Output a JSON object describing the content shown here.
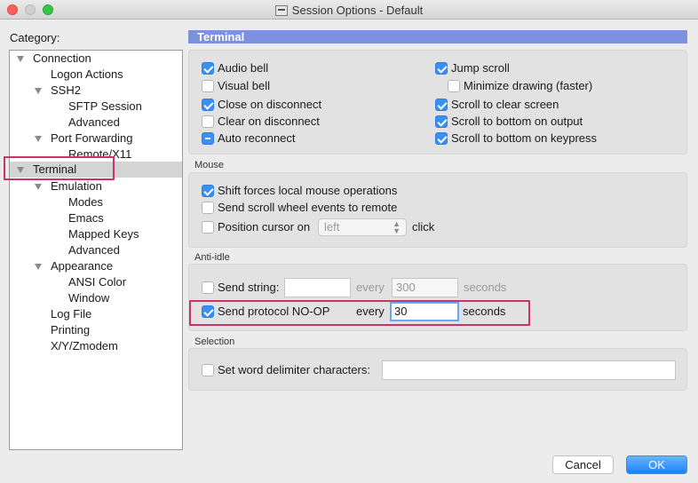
{
  "window": {
    "title": "Session Options - Default"
  },
  "category_label": "Category:",
  "tree": {
    "connection": "Connection",
    "logon_actions": "Logon Actions",
    "ssh2": "SSH2",
    "sftp_session": "SFTP Session",
    "advanced_ssh": "Advanced",
    "port_forwarding": "Port Forwarding",
    "remote_x11": "Remote/X11",
    "terminal": "Terminal",
    "emulation": "Emulation",
    "modes": "Modes",
    "emacs": "Emacs",
    "mapped_keys": "Mapped Keys",
    "advanced_emul": "Advanced",
    "appearance": "Appearance",
    "ansi_color": "ANSI Color",
    "window": "Window",
    "log_file": "Log File",
    "printing": "Printing",
    "xyzmodem": "X/Y/Zmodem"
  },
  "section_title": "Terminal",
  "terminal_options": {
    "audio_bell": {
      "label": "Audio bell",
      "checked": true
    },
    "visual_bell": {
      "label": "Visual bell",
      "checked": false
    },
    "close_on_disconnect": {
      "label": "Close on disconnect",
      "checked": true
    },
    "clear_on_disconnect": {
      "label": "Clear on disconnect",
      "checked": false
    },
    "auto_reconnect": {
      "label": "Auto reconnect",
      "state": "mixed"
    },
    "jump_scroll": {
      "label": "Jump scroll",
      "checked": true
    },
    "minimize_drawing": {
      "label": "Minimize drawing (faster)",
      "checked": false
    },
    "scroll_to_clear": {
      "label": "Scroll to clear screen",
      "checked": true
    },
    "scroll_bottom_output": {
      "label": "Scroll to bottom on output",
      "checked": true
    },
    "scroll_bottom_keypress": {
      "label": "Scroll to bottom on keypress",
      "checked": true
    }
  },
  "mouse": {
    "label": "Mouse",
    "shift_forces": {
      "label": "Shift forces local mouse operations",
      "checked": true
    },
    "send_scroll": {
      "label": "Send scroll wheel events to remote",
      "checked": false
    },
    "position_cursor": {
      "label": "Position cursor on",
      "checked": false
    },
    "position_select": "left",
    "click_label": "click"
  },
  "anti_idle": {
    "label": "Anti-idle",
    "send_string": {
      "label": "Send string:",
      "checked": false,
      "value": "",
      "every": "every",
      "interval": "300",
      "unit": "seconds"
    },
    "send_noop": {
      "label": "Send protocol NO-OP",
      "checked": true,
      "every": "every",
      "interval": "30",
      "unit": "seconds"
    }
  },
  "selection": {
    "label": "Selection",
    "word_delimiter": {
      "label": "Set word delimiter characters:",
      "checked": false,
      "value": ""
    }
  },
  "buttons": {
    "cancel": "Cancel",
    "ok": "OK"
  },
  "colors": {
    "accent": "#3b8ff0",
    "header": "#7d92df",
    "highlight": "#c9326b"
  }
}
